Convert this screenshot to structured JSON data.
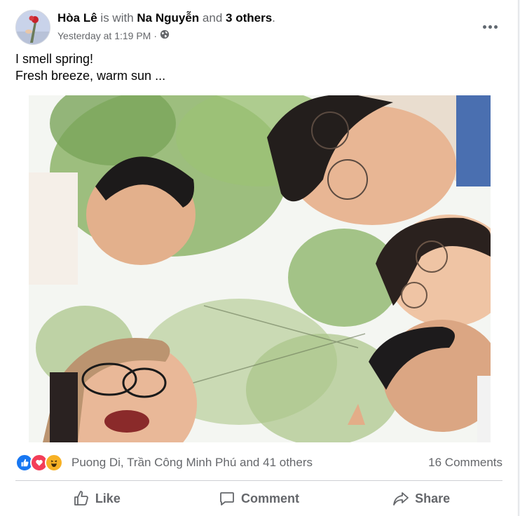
{
  "post": {
    "author": "Hòa Lê",
    "with_text": "is with",
    "tagged_person": "Na Nguyễn",
    "and_text": "and",
    "others_count": "3 others",
    "period": ".",
    "timestamp": "Yesterday at 1:19 PM",
    "separator": "·",
    "audience_icon": "globe-icon",
    "text_lines": [
      "I smell spring!",
      "Fresh breeze, warm sun ..."
    ]
  },
  "reactions": {
    "icons": [
      "like-icon",
      "love-icon",
      "haha-icon"
    ],
    "names_summary": "Puong Di, Trần Công Minh Phú and 41 others",
    "comments_count": "16 Comments"
  },
  "actions": {
    "like_label": "Like",
    "comment_label": "Comment",
    "share_label": "Share"
  },
  "colors": {
    "like_blue": "#1877f2",
    "love_red": "#f33e58",
    "haha_yellow": "#f7b125",
    "secondary_text": "#65676b"
  }
}
